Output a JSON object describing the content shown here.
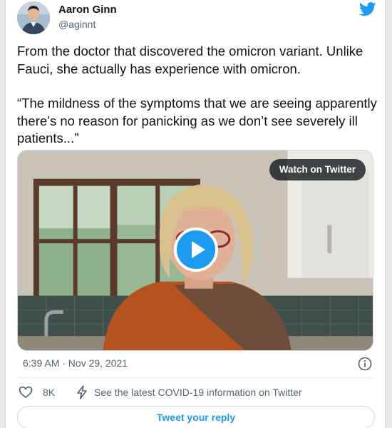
{
  "author": {
    "name": "Aaron Ginn",
    "handle": "@aginnt"
  },
  "tweet": {
    "paragraph_1": "From the doctor that discovered the omicron variant. Unlike Fauci, she actually has experience with omicron.",
    "paragraph_2": "“The mildness of the symptoms that we are seeing apparently there’s no reason for panicking as we don’t see severely ill patients...”"
  },
  "media": {
    "watch_label": "Watch on Twitter"
  },
  "meta": {
    "timestamp": "6:39 AM · Nov 29, 2021"
  },
  "actions": {
    "likes": "8K",
    "covid_info": "See the latest COVID-19 information on Twitter"
  },
  "reply": {
    "label": "Tweet your reply"
  },
  "colors": {
    "accent": "#1d9bf0",
    "text": "#0f1419",
    "muted": "#536471"
  },
  "icons": [
    "twitter-bird-icon",
    "play-icon",
    "info-icon",
    "heart-icon",
    "lightning-bolt-icon"
  ]
}
